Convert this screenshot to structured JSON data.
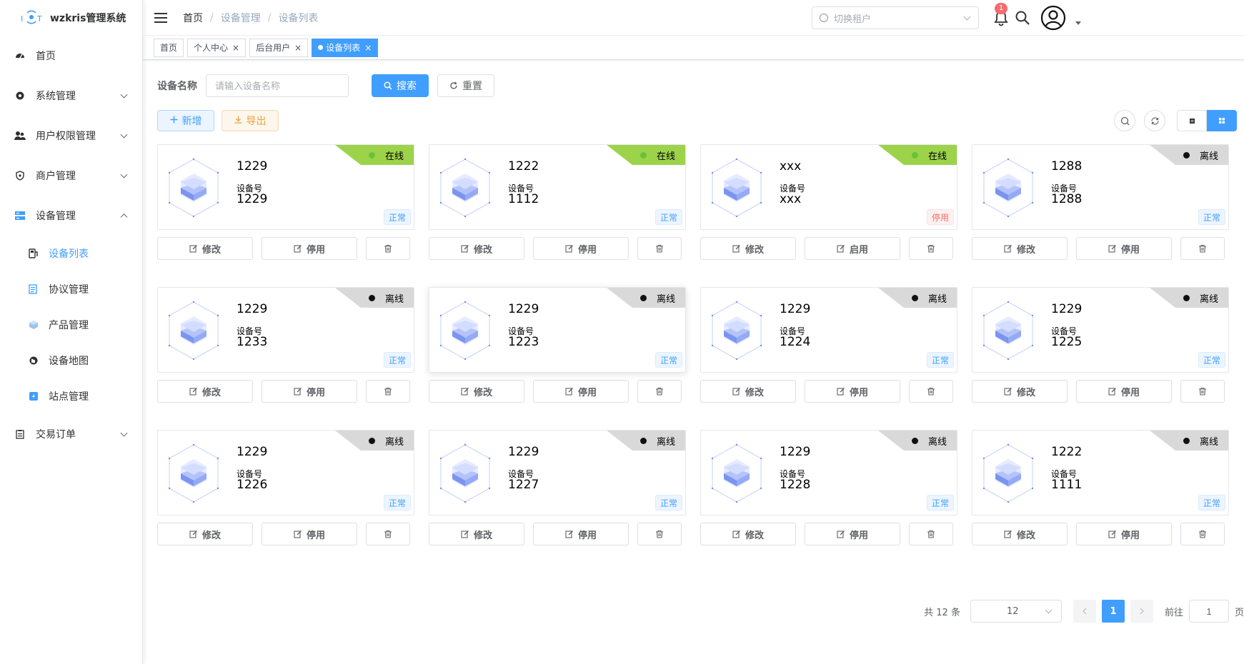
{
  "app": {
    "title": "wzkris管理系统"
  },
  "sidebar": {
    "items": [
      {
        "label": "首页",
        "icon": "dashboard-icon"
      },
      {
        "label": "系统管理",
        "icon": "gear-icon"
      },
      {
        "label": "用户权限管理",
        "icon": "users-icon"
      },
      {
        "label": "商户管理",
        "icon": "shield-icon"
      },
      {
        "label": "设备管理",
        "icon": "server-icon"
      },
      {
        "label": "交易订单",
        "icon": "clipboard-icon"
      }
    ],
    "sub_items": [
      {
        "label": "设备列表",
        "icon": "charger-icon"
      },
      {
        "label": "协议管理",
        "icon": "document-icon"
      },
      {
        "label": "产品管理",
        "icon": "cube-icon"
      },
      {
        "label": "设备地图",
        "icon": "globe-icon"
      },
      {
        "label": "站点管理",
        "icon": "station-icon"
      }
    ]
  },
  "header": {
    "breadcrumb": [
      "首页",
      "设备管理",
      "设备列表"
    ],
    "breadcrumb_sep": "/",
    "tenant_placeholder": "切换租户",
    "notification_count": "1"
  },
  "tags": [
    {
      "label": "首页"
    },
    {
      "label": "个人中心"
    },
    {
      "label": "后台用户"
    },
    {
      "label": "设备列表"
    }
  ],
  "tag_close": "×",
  "search": {
    "label": "设备名称",
    "placeholder": "请输入设备名称",
    "search_button": "搜索",
    "reset_button": "重置"
  },
  "toolbar": {
    "add_button": "新增",
    "export_button": "导出"
  },
  "card_labels": {
    "device_no": "设备号",
    "edit": "修改",
    "disable": "停用",
    "enable": "启用"
  },
  "devices": [
    {
      "name": "1229",
      "no": "1229",
      "online": "在线",
      "state": "正常"
    },
    {
      "name": "1222",
      "no": "1112",
      "online": "在线",
      "state": "正常"
    },
    {
      "name": "xxx",
      "no": "xxx",
      "online": "在线",
      "state": "停用"
    },
    {
      "name": "1288",
      "no": "1288",
      "online": "离线",
      "state": "正常"
    },
    {
      "name": "1229",
      "no": "1233",
      "online": "离线",
      "state": "正常"
    },
    {
      "name": "1229",
      "no": "1223",
      "online": "离线",
      "state": "正常"
    },
    {
      "name": "1229",
      "no": "1224",
      "online": "离线",
      "state": "正常"
    },
    {
      "name": "1229",
      "no": "1225",
      "online": "离线",
      "state": "正常"
    },
    {
      "name": "1229",
      "no": "1226",
      "online": "离线",
      "state": "正常"
    },
    {
      "name": "1229",
      "no": "1227",
      "online": "离线",
      "state": "正常"
    },
    {
      "name": "1229",
      "no": "1228",
      "online": "离线",
      "state": "正常"
    },
    {
      "name": "1222",
      "no": "1111",
      "online": "离线",
      "state": "正常"
    }
  ],
  "pagination": {
    "total_text": "共 12 条",
    "page_size": "12",
    "current_page": "1",
    "goto_label": "前往",
    "goto_value": "1",
    "page_unit": "页"
  },
  "colors": {
    "primary": "#409eff",
    "online": "#9cd34a",
    "offline": "#d9d9d9",
    "danger": "#f56c6c",
    "warning": "#e6a23c"
  }
}
